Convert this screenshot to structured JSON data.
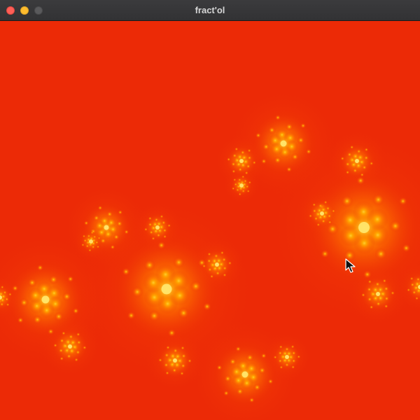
{
  "window": {
    "title": "fract'ol",
    "controls": [
      "close",
      "minimize",
      "zoom"
    ]
  },
  "canvas": {
    "content": "julia-set-fractal",
    "background_color": "#ec2a06",
    "glow_colors": [
      "#ff6a00",
      "#ffb000",
      "#ffd83a"
    ]
  },
  "cursor": {
    "icon": "arrow-cursor-icon"
  }
}
